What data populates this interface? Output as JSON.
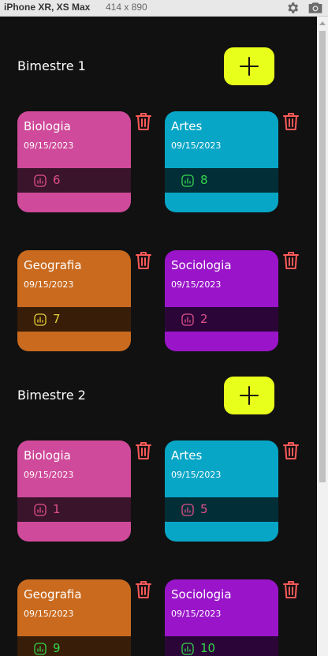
{
  "devtools": {
    "device_name": "iPhone XR, XS Max",
    "device_size": "414  x  890"
  },
  "colors": {
    "background": "#111111",
    "add_button": "#e8ff1c",
    "trash": "#ff5a5a",
    "biologia": "#cf4a9a",
    "artes": "#08a6c6",
    "geografia": "#c96a1e",
    "sociologia": "#9a15c9",
    "grade_pink": "#e0508a",
    "grade_green": "#33d64a",
    "grade_yellow": "#e6cf38"
  },
  "sections": [
    {
      "title": "Bimestre 1",
      "cards": [
        {
          "subject": "Biologia",
          "date": "09/15/2023",
          "grade": "6",
          "color": "#cf4a9a",
          "grade_color": "#e0508a"
        },
        {
          "subject": "Artes",
          "date": "09/15/2023",
          "grade": "8",
          "color": "#08a6c6",
          "grade_color": "#33d64a"
        },
        {
          "subject": "Geografia",
          "date": "09/15/2023",
          "grade": "7",
          "color": "#c96a1e",
          "grade_color": "#e6cf38"
        },
        {
          "subject": "Sociologia",
          "date": "09/15/2023",
          "grade": "2",
          "color": "#9a15c9",
          "grade_color": "#e0508a"
        }
      ]
    },
    {
      "title": "Bimestre 2",
      "cards": [
        {
          "subject": "Biologia",
          "date": "09/15/2023",
          "grade": "1",
          "color": "#cf4a9a",
          "grade_color": "#e0508a"
        },
        {
          "subject": "Artes",
          "date": "09/15/2023",
          "grade": "5",
          "color": "#08a6c6",
          "grade_color": "#e0508a"
        },
        {
          "subject": "Geografia",
          "date": "09/15/2023",
          "grade": "9",
          "color": "#c96a1e",
          "grade_color": "#33d64a"
        },
        {
          "subject": "Sociologia",
          "date": "09/15/2023",
          "grade": "10",
          "color": "#9a15c9",
          "grade_color": "#33d64a"
        }
      ]
    }
  ],
  "icons": {
    "add": "plus-icon",
    "delete": "trash-icon",
    "grade": "bar-chart-icon",
    "settings": "gear-icon",
    "screenshot": "camera-icon"
  }
}
